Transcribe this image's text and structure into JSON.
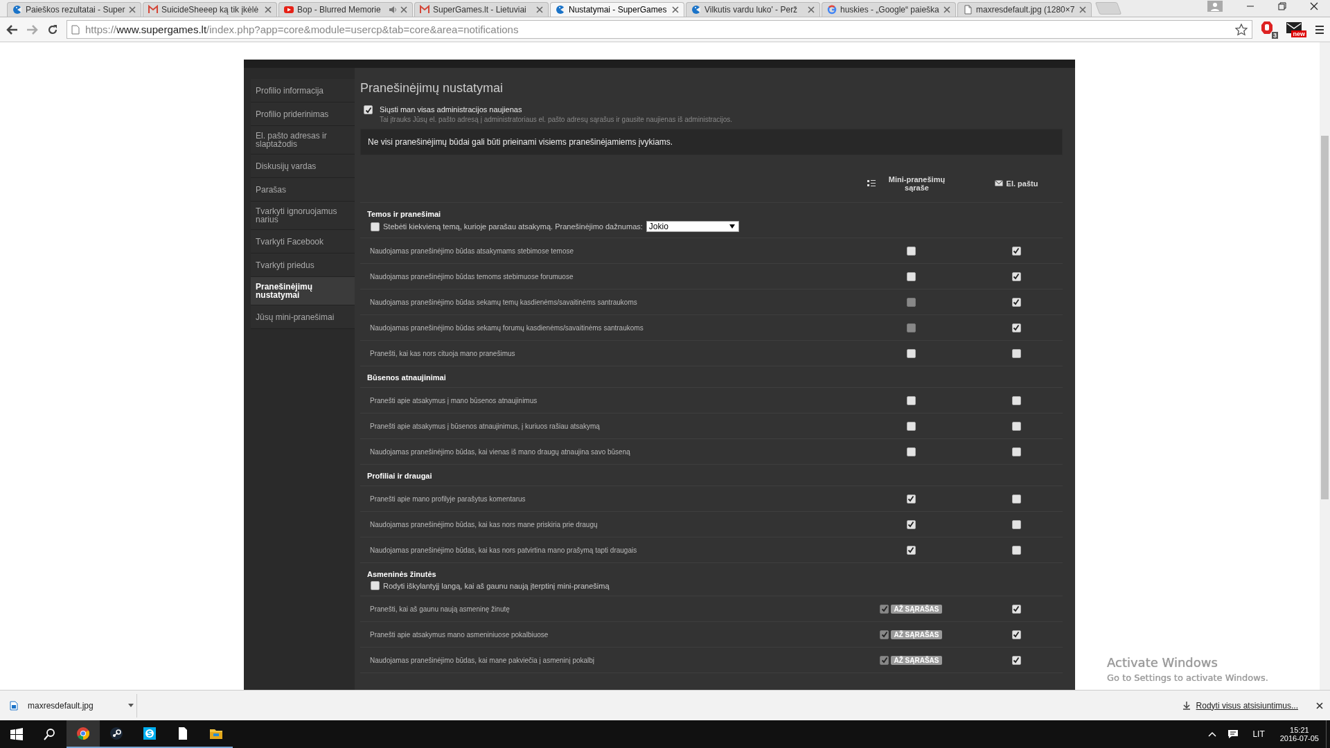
{
  "browser": {
    "tabs": [
      {
        "title": "Paieškos rezultatai - Super",
        "kind": "crescent",
        "audio": false,
        "selected": false
      },
      {
        "title": "SuicideSheeep ką tik įkėlė",
        "kind": "mail",
        "audio": false,
        "selected": false
      },
      {
        "title": "Bop - Blurred Memorie",
        "kind": "play",
        "audio": true,
        "selected": false
      },
      {
        "title": "SuperGames.lt - Lietuviai",
        "kind": "mail",
        "audio": false,
        "selected": false
      },
      {
        "title": "Nustatymai - SuperGames",
        "kind": "crescent",
        "audio": false,
        "selected": true
      },
      {
        "title": "Vilkutis vardu luko' - Perž",
        "kind": "crescent",
        "audio": false,
        "selected": false
      },
      {
        "title": "huskies - „Google“ paieška",
        "kind": "ring",
        "audio": false,
        "selected": false
      },
      {
        "title": "maxresdefault.jpg (1280×7",
        "kind": "file",
        "audio": false,
        "selected": false
      }
    ],
    "address": {
      "scheme": "https://",
      "host": "www.supergames.lt",
      "path": "/index.php?app=core&module=usercp&tab=core&area=notifications"
    },
    "extensions": [
      {
        "kind": "stop",
        "badge": "3"
      },
      {
        "kind": "mail",
        "badge": "new"
      }
    ]
  },
  "sidebar": {
    "items": [
      {
        "label": "Profilio informacija",
        "selected": false
      },
      {
        "label": "Profilio priderinimas",
        "selected": false
      },
      {
        "label": "El. pašto adresas ir slaptažodis",
        "selected": false
      },
      {
        "label": "Diskusijų vardas",
        "selected": false
      },
      {
        "label": "Parašas",
        "selected": false
      },
      {
        "label": "Tvarkyti ignoruojamus narius",
        "selected": false
      },
      {
        "label": "Tvarkyti Facebook",
        "selected": false
      },
      {
        "label": "Tvarkyti priedus",
        "selected": false
      },
      {
        "label": "Pranešinėjimų nustatymai",
        "selected": true
      },
      {
        "label": "Jūsų mini-pranešimai",
        "selected": false
      }
    ]
  },
  "content": {
    "title": "Pranešinėjimų nustatymai",
    "admin_news": {
      "label": "Siųsti man visas administracijos naujienas",
      "hint": "Tai įtrauks Jūsų el. pašto adresą į administratoriaus el. pašto adresų sąrašus ir gausite naujienas iš administracijos.",
      "checked": true
    },
    "notice": "Ne visi pranešinėjimų būdai gali būti prieinami visiems pranešinėjamiems įvykiams.",
    "columns": [
      {
        "label": "Mini-pranešimų sąraše",
        "kind": "list"
      },
      {
        "label": "El. paštu",
        "kind": "envelope"
      }
    ],
    "sections": [
      {
        "title": "Temos ir pranešimai",
        "option": {
          "label": "Stebėti kiekvieną temą, kurioje parašau atsakymą. Pranešinėjimo dažnumas:",
          "checked": false,
          "select": "Jokio"
        },
        "rows": [
          {
            "label": "Naudojamas pranešinėjimo būdas atsakymams stebimose temose",
            "mini": {
              "checked": false,
              "disabled": false
            },
            "email": {
              "checked": true
            }
          },
          {
            "label": "Naudojamas pranešinėjimo būdas temoms stebimuose forumuose",
            "mini": {
              "checked": false,
              "disabled": false
            },
            "email": {
              "checked": true
            }
          },
          {
            "label": "Naudojamas pranešinėjimo būdas sekamų temų kasdienėms/savaitinėms santraukoms",
            "mini": {
              "checked": false,
              "disabled": true
            },
            "email": {
              "checked": true
            }
          },
          {
            "label": "Naudojamas pranešinėjimo būdas sekamų forumų kasdienėms/savaitinėms santraukoms",
            "mini": {
              "checked": false,
              "disabled": true
            },
            "email": {
              "checked": true
            }
          },
          {
            "label": "Pranešti, kai kas nors cituoja mano pranešimus",
            "mini": {
              "checked": false,
              "disabled": false
            },
            "email": {
              "checked": false
            }
          }
        ]
      },
      {
        "title": "Būsenos atnaujinimai",
        "rows": [
          {
            "label": "Pranešti apie atsakymus į mano būsenos atnaujinimus",
            "mini": {
              "checked": false,
              "disabled": false
            },
            "email": {
              "checked": false
            }
          },
          {
            "label": "Pranešti apie atsakymus į būsenos atnaujinimus, į kuriuos rašiau atsakymą",
            "mini": {
              "checked": false,
              "disabled": false
            },
            "email": {
              "checked": false
            }
          },
          {
            "label": "Naudojamas pranešinėjimo būdas, kai vienas iš mano draugų atnaujina savo būseną",
            "mini": {
              "checked": false,
              "disabled": false
            },
            "email": {
              "checked": false
            }
          }
        ]
      },
      {
        "title": "Profiliai ir draugai",
        "rows": [
          {
            "label": "Pranešti apie mano profilyje parašytus komentarus",
            "mini": {
              "checked": true,
              "disabled": false
            },
            "email": {
              "checked": false
            }
          },
          {
            "label": "Naudojamas pranešinėjimo būdas, kai kas nors mane priskiria prie draugų",
            "mini": {
              "checked": true,
              "disabled": false
            },
            "email": {
              "checked": false
            }
          },
          {
            "label": "Naudojamas pranešinėjimo būdas, kai kas nors patvirtina mano prašymą tapti draugais",
            "mini": {
              "checked": true,
              "disabled": false
            },
            "email": {
              "checked": false
            }
          }
        ]
      },
      {
        "title": "Asmeninės žinutės",
        "option": {
          "label": "Rodyti iškylantyjį langą, kai aš gaunu naują įterptinį mini-pranešimą",
          "checked": false
        },
        "rows": [
          {
            "label": "Pranešti, kai aš gaunu naują asmeninę žinutę",
            "mini": {
              "checked": true,
              "disabled": true,
              "badge": "AŽ SĄRAŠAS"
            },
            "email": {
              "checked": true
            }
          },
          {
            "label": "Pranešti apie atsakymus mano asmeniniuose pokalbiuose",
            "mini": {
              "checked": true,
              "disabled": true,
              "badge": "AŽ SĄRAŠAS"
            },
            "email": {
              "checked": true
            }
          },
          {
            "label": "Naudojamas pranešinėjimo būdas, kai mane pakviečia į asmeninį pokalbį",
            "mini": {
              "checked": true,
              "disabled": true,
              "badge": "AŽ SĄRAŠAS"
            },
            "email": {
              "checked": true
            }
          }
        ]
      }
    ]
  },
  "watermark": {
    "title": "Activate Windows",
    "subtitle": "Go to Settings to activate Windows."
  },
  "download_bar": {
    "file": "maxresdefault.jpg",
    "show_all": "Rodyti visus atsisiuntimus..."
  },
  "taskbar": {
    "apps": [
      {
        "kind": "start"
      },
      {
        "kind": "search"
      },
      {
        "kind": "chrome"
      },
      {
        "kind": "steam"
      },
      {
        "kind": "skype"
      },
      {
        "kind": "file"
      },
      {
        "kind": "folder"
      }
    ],
    "language": "LIT",
    "time": "15:21",
    "date": "2016-07-05"
  }
}
